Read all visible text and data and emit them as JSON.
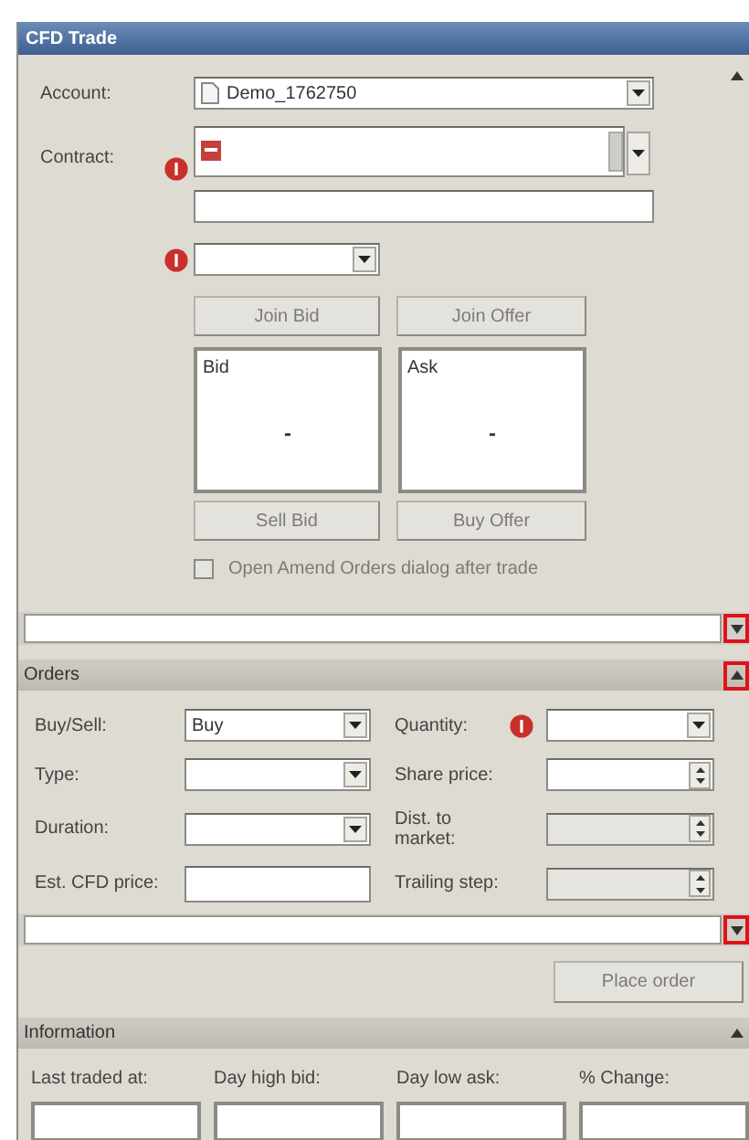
{
  "window": {
    "title": "CFD Trade"
  },
  "trade": {
    "account": {
      "label": "Account:",
      "value": "Demo_1762750"
    },
    "contract": {
      "label": "Contract:",
      "error": true
    },
    "selector": {
      "error": true
    },
    "top_buttons": [
      {
        "label": "Join Bid",
        "disabled": true
      },
      {
        "label": "Join Offer",
        "disabled": true
      }
    ],
    "quotes": [
      {
        "label": "Bid",
        "value": "-"
      },
      {
        "label": "Ask",
        "value": "-"
      }
    ],
    "bottom_buttons": [
      {
        "label": "Sell Bid",
        "disabled": true
      },
      {
        "label": "Buy Offer",
        "disabled": true
      }
    ],
    "open_amend_checkbox": {
      "label": "Open Amend Orders dialog after trade",
      "checked": false,
      "disabled": true
    },
    "message_bar": {
      "highlighted": true
    }
  },
  "orders": {
    "title": "Orders",
    "highlighted": true,
    "fields": [
      {
        "label": "Buy/Sell:",
        "kind": "dropdown",
        "value": "Buy",
        "error": false,
        "disabled": false
      },
      {
        "label": "Quantity:",
        "kind": "dropdown",
        "error": true,
        "disabled": false
      },
      {
        "label": "Type:",
        "kind": "dropdown",
        "error": false,
        "disabled": false
      },
      {
        "label": "Share price:",
        "kind": "spinner",
        "error": false,
        "disabled": false
      },
      {
        "label": "Duration:",
        "kind": "dropdown",
        "error": false,
        "disabled": false
      },
      {
        "label": "Dist. to market:",
        "kind": "spinner",
        "error": false,
        "disabled": true
      },
      {
        "label": "Est. CFD price:",
        "kind": "text",
        "error": false,
        "disabled": false
      },
      {
        "label": "Trailing step:",
        "kind": "spinner",
        "error": false,
        "disabled": true
      }
    ],
    "message_bar": {
      "highlighted": true
    },
    "place_order": {
      "label": "Place order",
      "disabled": true
    }
  },
  "information": {
    "title": "Information",
    "highlighted": false,
    "fields": [
      {
        "label": "Last traded at:"
      },
      {
        "label": "Day high bid:"
      },
      {
        "label": "Day low ask:"
      },
      {
        "label": "% Change:"
      }
    ]
  }
}
